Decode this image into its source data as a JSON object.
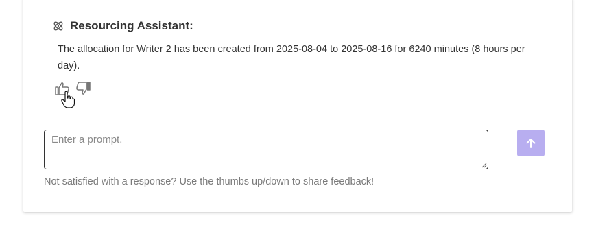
{
  "assistant": {
    "name": "Resourcing Assistant:",
    "icon": "atom-icon",
    "message": "The allocation for Writer 2 has been created from 2025-08-04 to 2025-08-16 for 6240 minutes (8 hours per day)."
  },
  "feedback": {
    "thumbs_up_icon": "thumbs-up-icon",
    "thumbs_down_icon": "thumbs-down-icon"
  },
  "prompt": {
    "placeholder": "Enter a prompt.",
    "value": ""
  },
  "send": {
    "icon": "arrow-up-icon",
    "color": "#b8aef0"
  },
  "hint": "Not satisfied with a response? Use the thumbs up/down to share feedback!"
}
